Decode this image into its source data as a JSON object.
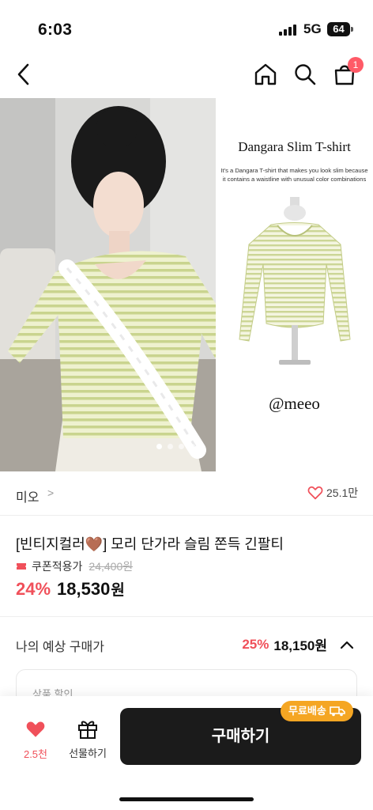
{
  "status": {
    "time": "6:03",
    "network": "5G",
    "battery": "64"
  },
  "nav": {
    "cart_count": "1"
  },
  "gallery": {
    "promo_title": "Dangara Slim T-shirt",
    "promo_desc": "It's a Dangara T-shirt that makes you look slim because it contains a waistline with unusual color combinations",
    "promo_handle": "@meeo",
    "page_count": 4,
    "active_page": 1
  },
  "seller": {
    "name": "미오",
    "chevron": ">",
    "likes": "25.1만"
  },
  "product": {
    "title": "[빈티지컬러🤎] 모리 단가라 슬림 쫀득 긴팔티",
    "coupon_label": "쿠폰적용가",
    "original_price": "24,400원",
    "discount": "24%",
    "price": "18,530",
    "price_unit": "원"
  },
  "expected": {
    "label": "나의 예상 구매가",
    "discount": "25%",
    "price": "18,150원"
  },
  "discount_box": {
    "label": "상품 할인"
  },
  "bottom": {
    "heart_count": "2.5천",
    "gift_label": "선물하기",
    "buy_label": "구매하기",
    "free_shipping": "무료배송"
  },
  "colors": {
    "accent_red": "#f0505a",
    "badge": "#ff5a67",
    "shipping_badge": "#f5a623",
    "button_dark": "#1b1b1b"
  }
}
